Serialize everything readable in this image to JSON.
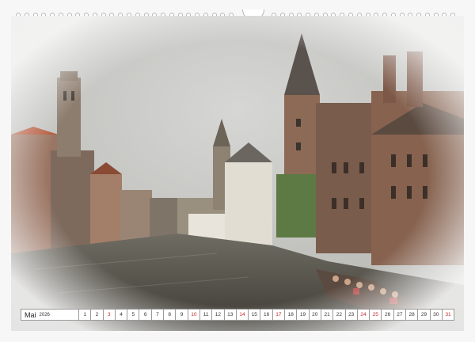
{
  "calendar": {
    "month": "Mai",
    "year": "2026",
    "days": [
      {
        "n": "1",
        "red": false
      },
      {
        "n": "2",
        "red": false
      },
      {
        "n": "3",
        "red": true
      },
      {
        "n": "4",
        "red": false
      },
      {
        "n": "5",
        "red": false
      },
      {
        "n": "6",
        "red": false
      },
      {
        "n": "7",
        "red": false
      },
      {
        "n": "8",
        "red": false
      },
      {
        "n": "9",
        "red": false
      },
      {
        "n": "10",
        "red": true
      },
      {
        "n": "11",
        "red": false
      },
      {
        "n": "12",
        "red": false
      },
      {
        "n": "13",
        "red": false
      },
      {
        "n": "14",
        "red": true
      },
      {
        "n": "15",
        "red": false
      },
      {
        "n": "16",
        "red": false
      },
      {
        "n": "17",
        "red": true
      },
      {
        "n": "18",
        "red": false
      },
      {
        "n": "19",
        "red": false
      },
      {
        "n": "20",
        "red": false
      },
      {
        "n": "21",
        "red": false
      },
      {
        "n": "22",
        "red": false
      },
      {
        "n": "23",
        "red": false
      },
      {
        "n": "24",
        "red": true
      },
      {
        "n": "25",
        "red": true
      },
      {
        "n": "26",
        "red": false
      },
      {
        "n": "27",
        "red": false
      },
      {
        "n": "28",
        "red": false
      },
      {
        "n": "29",
        "red": false
      },
      {
        "n": "30",
        "red": false
      },
      {
        "n": "31",
        "red": true
      }
    ],
    "holiday_color": "#c62828"
  },
  "binding_holes": 52
}
